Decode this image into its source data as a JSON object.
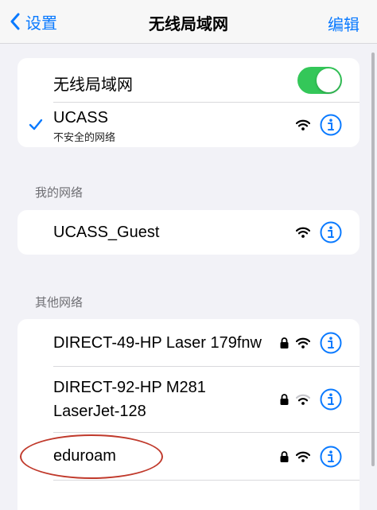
{
  "nav": {
    "back_label": "设置",
    "title": "无线局域网",
    "edit_label": "编辑"
  },
  "wlan": {
    "label": "无线局域网",
    "enabled": true
  },
  "connected": {
    "name": "UCASS",
    "subtitle": "不安全的网络"
  },
  "my_networks": {
    "header": "我的网络",
    "items": [
      {
        "name": "UCASS_Guest"
      }
    ]
  },
  "other_networks": {
    "header": "其他网络",
    "items": [
      {
        "name": "DIRECT-49-HP Laser 179fnw",
        "locked": true
      },
      {
        "name_line1": "DIRECT-92-HP M281",
        "name_line2": "LaserJet-128",
        "locked": true,
        "weak": true
      },
      {
        "name": "eduroam",
        "locked": true
      }
    ]
  },
  "colors": {
    "accent": "#0a7aff",
    "toggle_on": "#34c759",
    "highlight": "#c0392b"
  },
  "icons": {
    "back": "chevron-left-icon",
    "check": "checkmark-icon",
    "wifi": "wifi-icon",
    "info": "info-icon",
    "lock": "lock-icon"
  }
}
